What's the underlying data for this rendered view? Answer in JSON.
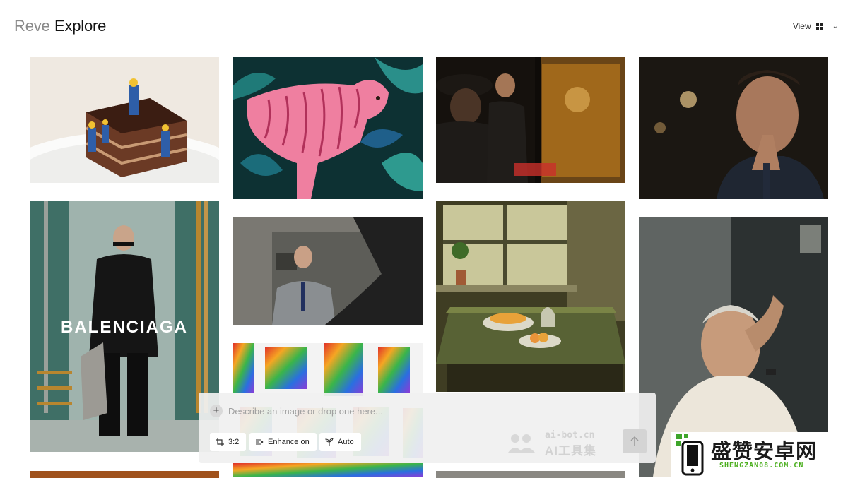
{
  "header": {
    "brand": "Reve",
    "title": "Explore",
    "view_label": "View",
    "view_icon": "grid-icon",
    "chevron_icon": "chevron-down-icon"
  },
  "gallery": {
    "tiles": [
      {
        "subject": "tiny-workers-on-chocolate-cake",
        "colors": [
          "#f2ede6",
          "#5a2f1c"
        ]
      },
      {
        "subject": "pink-tiger-in-jungle",
        "colors": [
          "#0e3b3d",
          "#ec6b8c"
        ]
      },
      {
        "subject": "men-in-dark-cafe",
        "colors": [
          "#1a1410",
          "#b8771e"
        ]
      },
      {
        "subject": "man-praying-hands",
        "colors": [
          "#17140f",
          "#8a6a4a"
        ]
      },
      {
        "subject": "fashion-model-ad",
        "overlay_text": "BALENCIAGA",
        "colors": [
          "#3e6e66",
          "#111111"
        ]
      },
      {
        "subject": "man-in-mirror",
        "colors": [
          "#6b6b66",
          "#2b2b2b"
        ]
      },
      {
        "subject": "kitchen-table-fruit-bowls",
        "colors": [
          "#58592c",
          "#d99c3a"
        ]
      },
      {
        "subject": "old-man-portrait",
        "colors": [
          "#2a2f2f",
          "#e8e2d6"
        ]
      },
      {
        "subject": "rainbow-abstract",
        "colors": [
          "#e03b2f",
          "#2a6fe0"
        ]
      }
    ]
  },
  "composer": {
    "add_icon": "plus-icon",
    "placeholder": "Describe an image or drop one here...",
    "aspect_label": "3:2",
    "aspect_icon": "crop-icon",
    "enhance_label": "Enhance on",
    "enhance_icon": "enhance-icon",
    "auto_label": "Auto",
    "auto_icon": "sprout-icon",
    "send_icon": "arrow-up-icon"
  },
  "watermarks": {
    "center_domain": "ai-bot.cn",
    "center_name": "AI工具集",
    "right_name": "盛赞安卓网",
    "right_domain": "SHENGZAN08.COM.CN"
  }
}
